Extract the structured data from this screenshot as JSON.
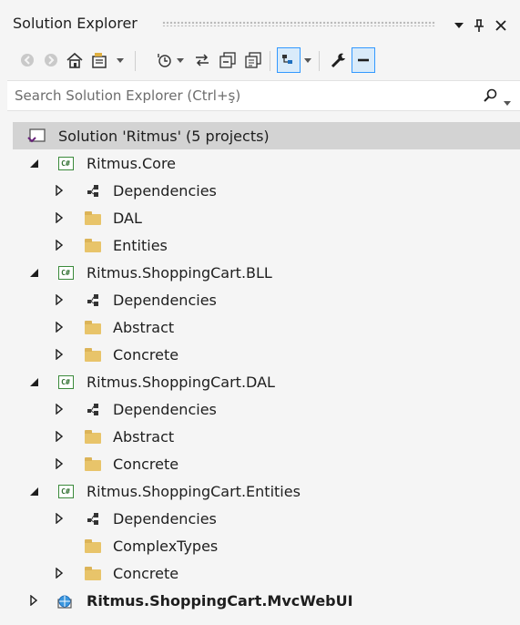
{
  "window": {
    "title": "Solution Explorer"
  },
  "search": {
    "placeholder": "Search Solution Explorer (Ctrl+ş)"
  },
  "tree": {
    "solution": "Solution 'Ritmus' (5 projects)",
    "core": {
      "name": "Ritmus.Core",
      "children": [
        "Dependencies",
        "DAL",
        "Entities"
      ]
    },
    "bll": {
      "name": "Ritmus.ShoppingCart.BLL",
      "children": [
        "Dependencies",
        "Abstract",
        "Concrete"
      ]
    },
    "dal": {
      "name": "Ritmus.ShoppingCart.DAL",
      "children": [
        "Dependencies",
        "Abstract",
        "Concrete"
      ]
    },
    "entities": {
      "name": "Ritmus.ShoppingCart.Entities",
      "children": [
        "Dependencies",
        "ComplexTypes",
        "Concrete"
      ]
    },
    "webui": {
      "name": "Ritmus.ShoppingCart.MvcWebUI"
    }
  },
  "icons": {
    "project_badge": "C#",
    "accent": "#3399ff",
    "folder": "#e8c46a"
  }
}
